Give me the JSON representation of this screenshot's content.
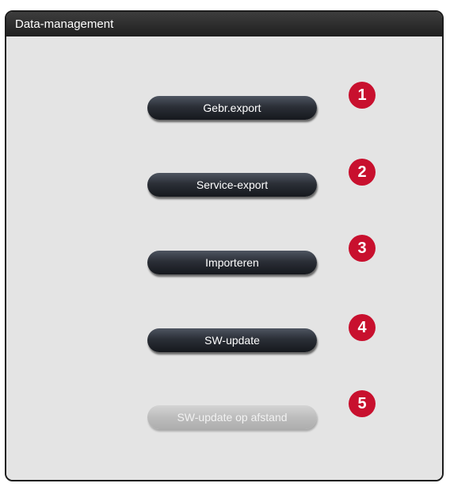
{
  "window": {
    "title": "Data-management"
  },
  "buttons": [
    {
      "label": "Gebr.export",
      "enabled": true
    },
    {
      "label": "Service-export",
      "enabled": true
    },
    {
      "label": "Importeren",
      "enabled": true
    },
    {
      "label": "SW-update",
      "enabled": true
    },
    {
      "label": "SW-update op afstand",
      "enabled": false
    }
  ],
  "callouts": [
    "1",
    "2",
    "3",
    "4",
    "5"
  ],
  "colors": {
    "titlebar": "#2a2a2a",
    "panel": "#e4e4e4",
    "button": "#2b2f37",
    "button_disabled": "#bdbdbd",
    "callout": "#c8102e"
  }
}
